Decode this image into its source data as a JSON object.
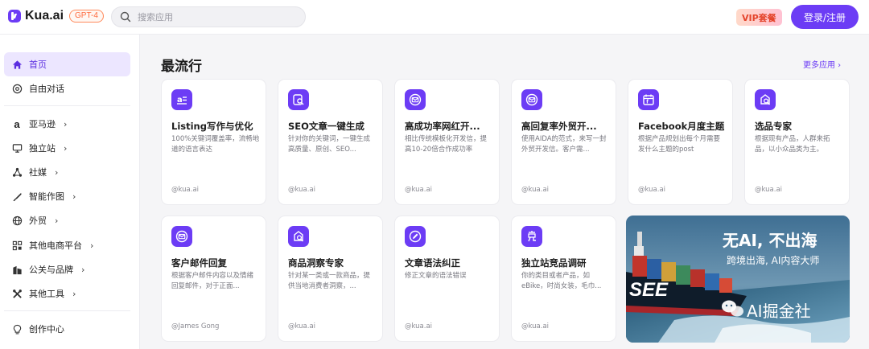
{
  "header": {
    "logo_text": "Kua.ai",
    "model_badge": "GPT-4",
    "search_placeholder": "搜索应用",
    "vip_label": "VIP套餐",
    "login_label": "登录/注册"
  },
  "colors": {
    "accent": "#6c3cf5",
    "vip_text": "#e4452c",
    "model_badge": "#ff6a3d"
  },
  "sidebar": {
    "items": [
      {
        "label": "首页",
        "icon": "home-icon",
        "active": true
      },
      {
        "label": "自由对话",
        "icon": "chat-icon"
      },
      {
        "label": "亚马逊",
        "icon": "amazon-icon",
        "chevron": "›"
      },
      {
        "label": "独立站",
        "icon": "monitor-icon",
        "chevron": "›"
      },
      {
        "label": "社媒",
        "icon": "share-icon",
        "chevron": "›"
      },
      {
        "label": "智能作图",
        "icon": "brush-icon",
        "chevron": "›"
      },
      {
        "label": "外贸",
        "icon": "globe-icon",
        "chevron": "›"
      },
      {
        "label": "其他电商平台",
        "icon": "grid-icon",
        "chevron": "›"
      },
      {
        "label": "公关与品牌",
        "icon": "building-icon",
        "chevron": "›"
      },
      {
        "label": "其他工具",
        "icon": "tools-icon",
        "chevron": "›"
      },
      {
        "label": "创作中心",
        "icon": "lightbulb-icon"
      }
    ]
  },
  "main": {
    "section_title": "最流行",
    "more_label": "更多应用 ›",
    "cards": [
      {
        "title": "Listing写作与优化",
        "desc": "100%关键词覆盖率，流畅地道的语言表达",
        "author": "@kua.ai",
        "icon": "text-doc-icon"
      },
      {
        "title": "SEO文章一键生成",
        "desc": "针对你的关键词，一键生成高质量、原创、SEO...",
        "author": "@kua.ai",
        "icon": "search-doc-icon"
      },
      {
        "title": "高成功率网红开...",
        "desc": "相比传统模板化开发信，提高10-20倍合作成功率",
        "author": "@kua.ai",
        "icon": "mail-icon"
      },
      {
        "title": "高回复率外贸开...",
        "desc": "使用AIDA的范式，来写一封外贸开发信。客户需...",
        "author": "@kua.ai",
        "icon": "mail-icon"
      },
      {
        "title": "Facebook月度主题",
        "desc": "根据产品规划出每个月需要发什么主题的post",
        "author": "@kua.ai",
        "icon": "calendar-icon"
      },
      {
        "title": "选品专家",
        "desc": "根据现有产品，人群来拓品，以小众品类为主。",
        "author": "@kua.ai",
        "icon": "search-doc-icon"
      },
      {
        "title": "客户邮件回复",
        "desc": "根据客户邮件内容以及情绪回复邮件，对于正面...",
        "author": "@James Gong",
        "icon": "mail-icon"
      },
      {
        "title": "商品洞察专家",
        "desc": "针对某一类或一款商品，提供当地消费者洞察，...",
        "author": "@kua.ai",
        "icon": "search-doc-icon"
      },
      {
        "title": "文章语法纠正",
        "desc": "修正文章的语法错误",
        "author": "@kua.ai",
        "icon": "edit-icon"
      },
      {
        "title": "独立站竞品调研",
        "desc": "你的类目或者产品，如eBike，时尚女装，毛巾...",
        "author": "@kua.ai",
        "icon": "compete-icon"
      }
    ],
    "banner": {
      "headline": "无AI, 不出海",
      "subline": "跨境出海, AI内容大师",
      "brand": "AI掘金社",
      "hull_text": "SEE"
    }
  }
}
